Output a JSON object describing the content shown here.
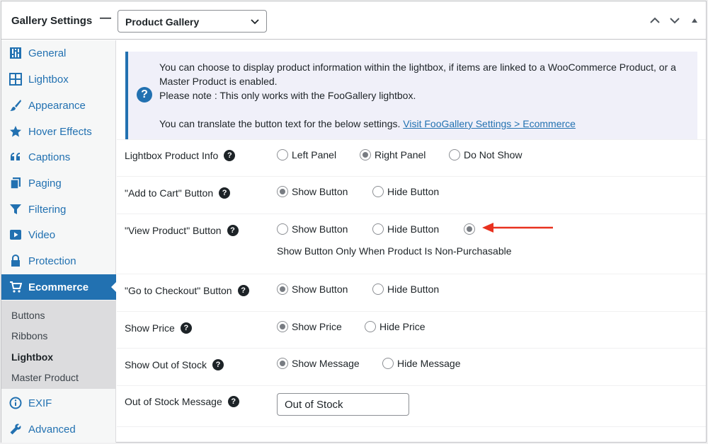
{
  "header": {
    "title": "Gallery Settings",
    "dash": "—",
    "select_value": "Product Gallery"
  },
  "sidebar": {
    "items": [
      {
        "label": "General",
        "icon": "sliders-icon"
      },
      {
        "label": "Lightbox",
        "icon": "grid-icon"
      },
      {
        "label": "Appearance",
        "icon": "brush-icon"
      },
      {
        "label": "Hover Effects",
        "icon": "star-icon"
      },
      {
        "label": "Captions",
        "icon": "quote-icon"
      },
      {
        "label": "Paging",
        "icon": "pages-icon"
      },
      {
        "label": "Filtering",
        "icon": "filter-icon"
      },
      {
        "label": "Video",
        "icon": "video-icon"
      },
      {
        "label": "Protection",
        "icon": "lock-icon"
      },
      {
        "label": "Ecommerce",
        "icon": "cart-icon"
      },
      {
        "label": "EXIF",
        "icon": "info-icon"
      },
      {
        "label": "Advanced",
        "icon": "wrench-icon"
      }
    ],
    "submenu": [
      "Buttons",
      "Ribbons",
      "Lightbox",
      "Master Product"
    ]
  },
  "notice": {
    "line1": "You can choose to display product information within the lightbox, if items are linked to a WooCommerce Product, or a Master Product is enabled.",
    "line2": "Please note : This only works with the FooGallery lightbox.",
    "line3": "You can translate the button text for the below settings.",
    "link": "Visit FooGallery Settings > Ecommerce"
  },
  "settings": {
    "lightbox_info": {
      "label": "Lightbox Product Info",
      "opt1": "Left Panel",
      "opt2": "Right Panel",
      "opt3": "Do Not Show"
    },
    "add_to_cart": {
      "label": "\"Add to Cart\" Button",
      "opt1": "Show Button",
      "opt2": "Hide Button"
    },
    "view_product": {
      "label": "\"View Product\" Button",
      "opt1": "Show Button",
      "opt2": "Hide Button",
      "opt3": "Show Button Only When Product Is Non-Purchasable"
    },
    "checkout": {
      "label": "\"Go to Checkout\" Button",
      "opt1": "Show Button",
      "opt2": "Hide Button"
    },
    "show_price": {
      "label": "Show Price",
      "opt1": "Show Price",
      "opt2": "Hide Price"
    },
    "out_of_stock": {
      "label": "Show Out of Stock",
      "opt1": "Show Message",
      "opt2": "Hide Message"
    },
    "stock_message": {
      "label": "Out of Stock Message",
      "value": "Out of Stock"
    }
  },
  "colors": {
    "accent": "#2271b1",
    "arrow": "#e8311f"
  }
}
